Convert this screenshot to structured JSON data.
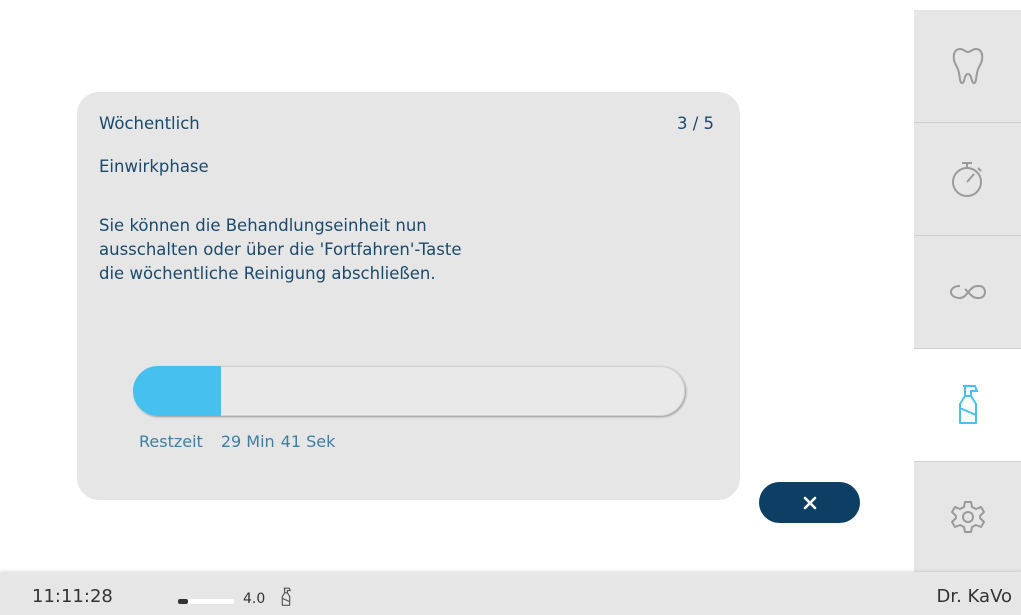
{
  "dialog": {
    "title": "Wöchentlich",
    "step": "3 / 5",
    "phase": "Einwirkphase",
    "message_lines": [
      "Sie können die Behandlungseinheit nun",
      "ausschalten oder über die 'Fortfahren'-Taste",
      "die wöchentliche Reinigung abschließen."
    ],
    "progress_fraction": 0.16,
    "remaining_label": "Restzeit",
    "remaining_min": "29 Min",
    "remaining_sec": "41 Sek"
  },
  "close_button": {
    "icon": "close-icon"
  },
  "sidebar": {
    "items": [
      {
        "icon": "tooth-icon",
        "active": false
      },
      {
        "icon": "stopwatch-icon",
        "active": false
      },
      {
        "icon": "infinity-icon",
        "active": false
      },
      {
        "icon": "spray-bottle-icon",
        "active": true
      },
      {
        "icon": "gear-icon",
        "active": false
      }
    ]
  },
  "statusbar": {
    "time": "11:11:28",
    "level_fraction": 0.18,
    "version": "4.0",
    "bottle_icon": "spray-bottle-icon",
    "user": "Dr. KaVo"
  },
  "colors": {
    "accent": "#45c0ef",
    "text_dark_blue": "#1a4a6b",
    "button_navy": "#0c3f63",
    "panel_gray": "#e6e6e6"
  }
}
